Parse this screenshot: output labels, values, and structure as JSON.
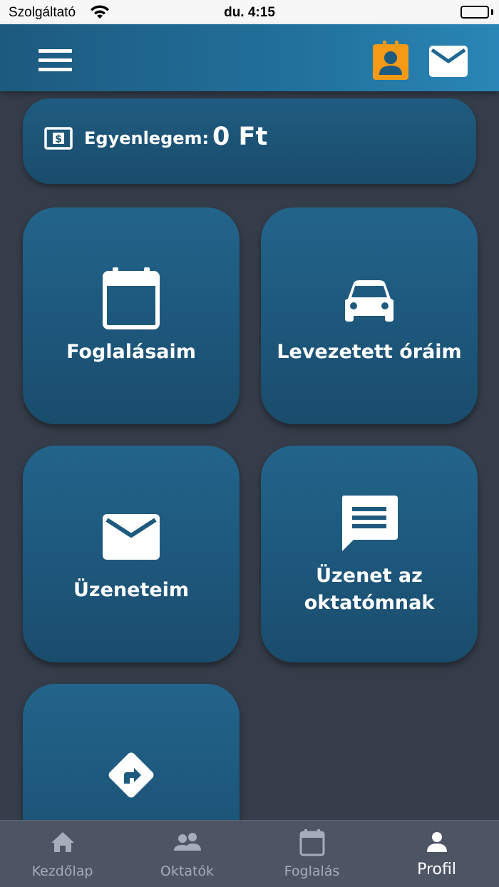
{
  "status_bar": {
    "carrier": "Szolgáltató",
    "time": "du. 4:15"
  },
  "balance": {
    "label": "Egyenlegem:",
    "value": "0 Ft"
  },
  "tiles": [
    {
      "label": "Foglalásaim",
      "icon": "calendar-icon"
    },
    {
      "label": "Levezetett óráim",
      "icon": "car-icon"
    },
    {
      "label": "Üzeneteim",
      "icon": "mail-icon"
    },
    {
      "label_line1": "Üzenet az",
      "label_line2": "oktatómnak",
      "icon": "chat-icon"
    },
    {
      "label": "",
      "icon": "directions-icon"
    }
  ],
  "tabbar": {
    "items": [
      {
        "label": "Kezdőlap",
        "icon": "home-icon"
      },
      {
        "label": "Oktatók",
        "icon": "people-icon"
      },
      {
        "label": "Foglalás",
        "icon": "calendar-icon"
      },
      {
        "label": "Profil",
        "icon": "person-icon",
        "active": true
      }
    ]
  },
  "colors": {
    "background": "#353d4a",
    "header_gradient_start": "#1d5a7f",
    "header_gradient_end": "#2a86b6",
    "tile": "#1f5c80",
    "profile_accent": "#f39a17",
    "tab_inactive": "#a5adba",
    "tab_active": "#ffffff"
  }
}
